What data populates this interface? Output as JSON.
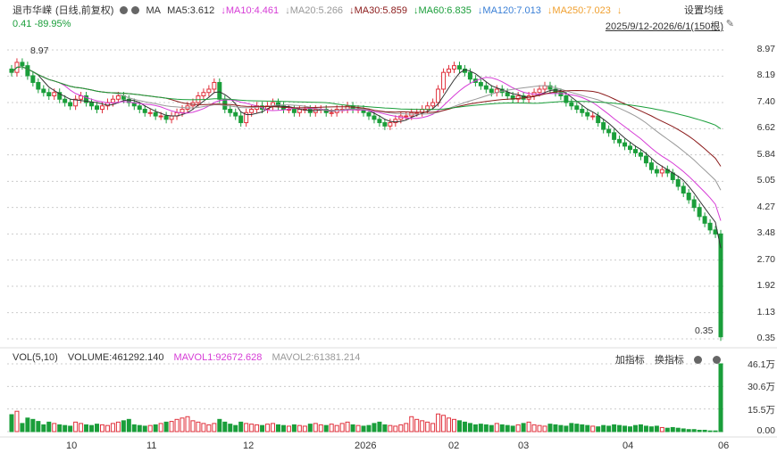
{
  "header": {
    "symbol": "退市华嵘",
    "period": "(日线,前复权)",
    "ma_label": "MA",
    "ma5": "MA5:3.612",
    "ma10": "↓MA10:4.461",
    "ma20": "↓MA20:5.266",
    "ma30": "↓MA30:5.859",
    "ma60": "↓MA60:6.835",
    "ma120": "↓MA120:7.013",
    "ma250": "↓MA250:7.023",
    "ma250_arrow": "↓",
    "change": "0.41  -89.95%",
    "settings": "设置均线",
    "range": "2025/9/12-2026/6/1(150根)"
  },
  "volume_header": {
    "vol": "VOL(5,10)",
    "volume": "VOLUME:461292.140",
    "mavol1": "MAVOL1:92672.628",
    "mavol2": "MAVOL2:61381.214",
    "add_indicator": "加指标",
    "switch_indicator": "换指标"
  },
  "colors": {
    "up": "#e0303b",
    "down": "#1a9e3a",
    "ma5": "#333333",
    "ma10": "#d63cd6",
    "ma20": "#999999",
    "ma30": "#8b1a1a",
    "ma60": "#1a9e3a",
    "ma120": "#3a7fd6",
    "ma250": "#f0a030"
  },
  "chart_data": {
    "type": "candlestick",
    "price_axis": {
      "ticks": [
        "8.97",
        "8.19",
        "7.40",
        "6.62",
        "5.84",
        "5.05",
        "4.27",
        "3.48",
        "2.70",
        "1.92",
        "1.13",
        "0.35"
      ],
      "ylim": [
        0.35,
        8.97
      ]
    },
    "volume_axis": {
      "ticks": [
        "46.1万",
        "30.6万",
        "15.5万",
        "0.00"
      ]
    },
    "x_ticks": [
      "10",
      "11",
      "12",
      "2026",
      "02",
      "03",
      "04",
      "06"
    ],
    "annotations": {
      "high": "8.97",
      "low": "0.35"
    },
    "series_close_approx": [
      8.3,
      8.6,
      8.5,
      8.2,
      8.0,
      7.8,
      7.7,
      7.6,
      7.7,
      7.5,
      7.4,
      7.3,
      7.5,
      7.6,
      7.4,
      7.3,
      7.2,
      7.3,
      7.4,
      7.5,
      7.6,
      7.5,
      7.4,
      7.3,
      7.2,
      7.1,
      7.1,
      7.0,
      7.0,
      6.9,
      7.0,
      7.1,
      7.2,
      7.3,
      7.4,
      7.6,
      7.7,
      7.8,
      8.0,
      7.5,
      7.2,
      7.1,
      7.0,
      6.8,
      7.1,
      7.2,
      7.3,
      7.2,
      7.3,
      7.4,
      7.3,
      7.2,
      7.2,
      7.1,
      7.2,
      7.2,
      7.1,
      7.2,
      7.2,
      7.1,
      7.1,
      7.2,
      7.2,
      7.3,
      7.2,
      7.2,
      7.1,
      7.0,
      6.9,
      6.8,
      6.7,
      6.8,
      6.9,
      7.0,
      7.0,
      7.1,
      7.1,
      7.2,
      7.3,
      7.4,
      7.8,
      8.3,
      8.4,
      8.5,
      8.4,
      8.3,
      8.1,
      8.0,
      7.9,
      7.8,
      7.7,
      7.8,
      7.7,
      7.6,
      7.5,
      7.6,
      7.5,
      7.6,
      7.7,
      7.8,
      7.9,
      7.8,
      7.7,
      7.6,
      7.4,
      7.3,
      7.2,
      7.1,
      7.0,
      7.0,
      6.8,
      6.6,
      6.5,
      6.3,
      6.2,
      6.1,
      6.0,
      5.9,
      5.8,
      5.6,
      5.4,
      5.3,
      5.4,
      5.3,
      5.1,
      4.9,
      4.7,
      4.5,
      4.27,
      4.0,
      3.8,
      3.6,
      3.48,
      0.41
    ],
    "volume_approx": [
      25,
      30,
      12,
      20,
      18,
      15,
      10,
      14,
      12,
      10,
      9,
      8,
      14,
      12,
      10,
      9,
      11,
      10,
      9,
      12,
      14,
      16,
      18,
      10,
      9,
      8,
      9,
      10,
      12,
      14,
      15,
      18,
      20,
      22,
      16,
      14,
      12,
      10,
      12,
      18,
      14,
      11,
      9,
      14,
      12,
      11,
      10,
      9,
      11,
      12,
      10,
      9,
      8,
      10,
      9,
      8,
      11,
      12,
      10,
      9,
      11,
      9,
      12,
      14,
      10,
      9,
      8,
      9,
      12,
      14,
      10,
      9,
      8,
      10,
      12,
      22,
      18,
      16,
      14,
      12,
      26,
      24,
      20,
      18,
      16,
      14,
      12,
      10,
      11,
      10,
      9,
      12,
      10,
      9,
      8,
      10,
      12,
      14,
      10,
      9,
      8,
      11,
      10,
      9,
      8,
      12,
      11,
      10,
      9,
      8,
      7,
      9,
      8,
      10,
      9,
      8,
      7,
      9,
      10,
      8,
      7,
      8,
      6,
      5,
      6,
      5,
      4,
      3,
      3,
      2,
      2,
      1,
      1,
      100
    ]
  }
}
